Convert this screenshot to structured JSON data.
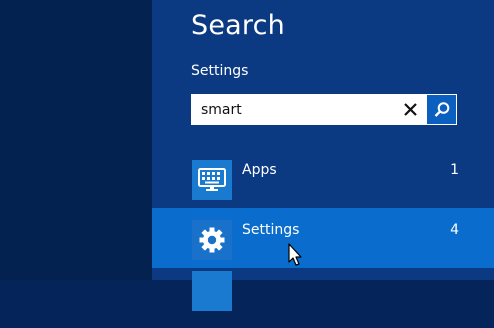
{
  "charm": {
    "title": "Search",
    "scope_label": "Settings",
    "search": {
      "value": "smart",
      "placeholder": ""
    },
    "clear_icon": "close-icon",
    "search_icon": "search-icon"
  },
  "results": [
    {
      "label": "Apps",
      "count": "1",
      "icon": "keyboard-icon",
      "selected": false
    },
    {
      "label": "Settings",
      "count": "4",
      "icon": "gear-icon",
      "selected": true
    }
  ],
  "colors": {
    "desktop_bg": "#03224f",
    "panel_bg": "#0b3a82",
    "selected_row": "#0a6ccc",
    "icon_tile": "#1a7ad0",
    "search_button": "#0b5fbf"
  }
}
